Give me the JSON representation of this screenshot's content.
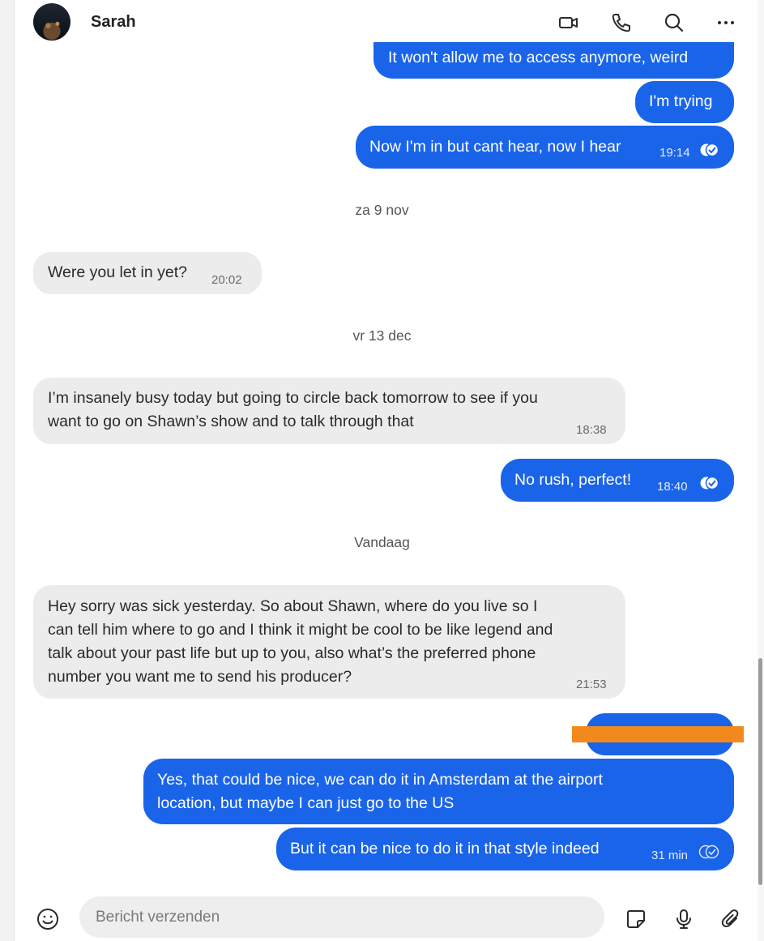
{
  "header": {
    "contact_name": "Sarah",
    "icons": [
      "video-call-icon",
      "phone-call-icon",
      "search-icon",
      "more-options-icon"
    ]
  },
  "messages": [
    {
      "dir": "out",
      "lines": [
        "It won't allow me to access anymore, weird"
      ]
    },
    {
      "dir": "out",
      "lines": [
        "I'm trying"
      ]
    },
    {
      "dir": "out",
      "lines": [
        "Now I'm in but cant hear, now I hear"
      ],
      "time": "19:14",
      "status": "read"
    },
    {
      "type": "date",
      "label": "za 9 nov"
    },
    {
      "dir": "in",
      "lines": [
        "Were you let in yet?"
      ],
      "time": "20:02"
    },
    {
      "type": "date",
      "label": "vr 13 dec"
    },
    {
      "dir": "in",
      "lines": [
        "I’m insanely busy today but going to circle back tomorrow to see if you",
        "want to go on Shawn’s show and to talk through that"
      ],
      "time": "18:38"
    },
    {
      "dir": "out",
      "lines": [
        "No rush, perfect!"
      ],
      "time": "18:40",
      "status": "read"
    },
    {
      "type": "date",
      "label": "Vandaag"
    },
    {
      "dir": "in",
      "lines": [
        "Hey sorry was sick yesterday. So about Shawn, where do you live so I",
        "can tell him where to go and I think it might be cool to be like legend and",
        "talk about your past life but up to you, also what’s the preferred phone",
        "number you want me to send his producer?"
      ],
      "time": "21:53"
    },
    {
      "dir": "out",
      "redacted": true
    },
    {
      "dir": "out",
      "lines": [
        "Yes, that could be nice, we can do it in Amsterdam at the airport",
        "location, but maybe I can just go to the US"
      ]
    },
    {
      "dir": "out",
      "lines": [
        "But it can be nice to do it in that style indeed"
      ],
      "time": "31 min",
      "status": "delivered"
    }
  ],
  "composer": {
    "placeholder": "Bericht verzenden",
    "icons": [
      "emoji-icon",
      "sticker-icon",
      "microphone-icon",
      "attachment-icon"
    ]
  },
  "colors": {
    "outgoing_bubble": "#1a64ea",
    "incoming_bubble": "#ececec",
    "redaction_bar": "#f2891c"
  }
}
